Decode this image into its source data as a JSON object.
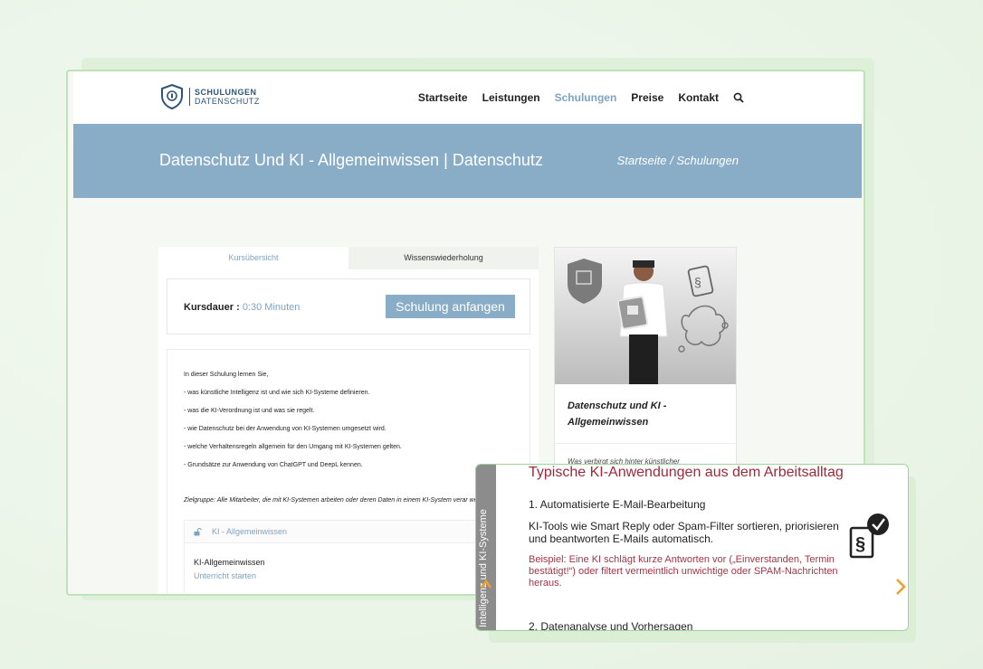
{
  "header": {
    "logo": {
      "line1": "SCHULUNGEN",
      "line2": "DATENSCHUTZ"
    },
    "nav": [
      {
        "label": "Startseite",
        "active": false
      },
      {
        "label": "Leistungen",
        "active": false
      },
      {
        "label": "Schulungen",
        "active": true
      },
      {
        "label": "Preise",
        "active": false
      },
      {
        "label": "Kontakt",
        "active": false
      }
    ],
    "search_icon": "search-icon"
  },
  "hero": {
    "title": "Datenschutz Und KI - Allgemeinwissen | Datenschutz",
    "breadcrumb": "Startseite / Schulungen"
  },
  "course": {
    "tabs": [
      "Kursübersicht",
      "Wissenswiederholung"
    ],
    "duration_label": "Kursdauer :",
    "duration_value": "0:30 Minuten",
    "start_button": "Schulung anfangen",
    "intro": "In dieser Schulung lernen Sie,",
    "items": [
      "- was künstliche Intelligenz ist und wie sich KI-Systeme definieren.",
      "- was die KI-Verordnung ist und was sie regelt.",
      "- wie Datenschutz bei der Anwendung von KI-Systemen umgesetzt wird.",
      "- welche Verhaltensregeln allgemein für den Umgang mit KI-Systemen gelten.",
      "- Grundsätze zur Anwendung von ChatGPT und DeepL kennen."
    ],
    "target_group": "Zielgruppe: Alle Mitarbeiter, die mit KI-Systemen arbeiten oder deren Daten in einem KI-System verar werden.",
    "module_title": "KI - Allgemeinwissen",
    "lesson_title": "KI-Allgemeinwissen",
    "lesson_link": "Unterricht starten"
  },
  "sidebar": {
    "card_title": "Datenschutz und KI - Allgemeinwissen",
    "teaser": "Was verbirgt sich hinter künstlicher"
  },
  "slide": {
    "side_label": "Intelligenz und KI-Systeme",
    "title": "Typische KI-Anwendungen aus dem Arbeitsalltag",
    "heading1": "1. Automatisierte E-Mail-Bearbeitung",
    "paragraph": "KI-Tools wie Smart Reply oder Spam-Filter sortieren, priorisieren und beantworten E-Mails automatisch.",
    "example": "Beispiel: Eine KI schlägt kurze Antworten vor („Einverstanden, Termin bestätigt!“) oder filtert vermeintlich unwichtige oder SPAM-Nachrichten heraus.",
    "heading2": "2. Datenanalyse und Vorhersagen"
  },
  "colors": {
    "accent": "#89adc7",
    "link": "#7fa3bf",
    "slide_red": "#9b2a3a",
    "arrow_orange": "#f0a02a",
    "frame_green": "#bfe3b8"
  }
}
